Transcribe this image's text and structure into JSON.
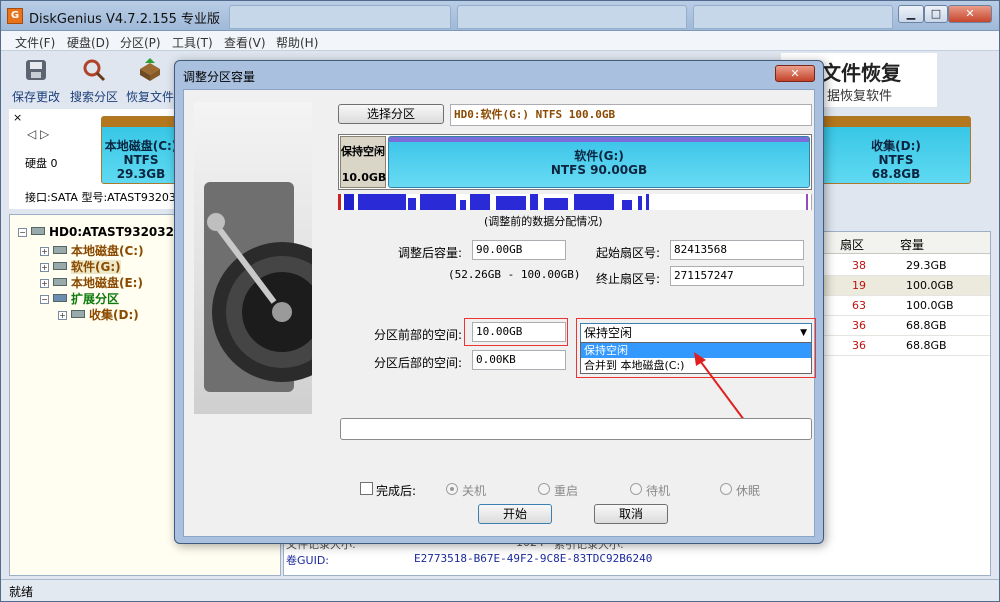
{
  "window": {
    "icon": "G",
    "title": "DiskGenius V4.7.2.155 专业版",
    "min_label": "▁",
    "max_label": "□",
    "close_label": "✕"
  },
  "menu": [
    "文件(F)",
    "硬盘(D)",
    "分区(P)",
    "工具(T)",
    "查看(V)",
    "帮助(H)"
  ],
  "toolbar": [
    {
      "label": "保存更改",
      "icon": "save-icon"
    },
    {
      "label": "搜索分区",
      "icon": "search-icon"
    },
    {
      "label": "恢复文件",
      "icon": "recover-icon"
    }
  ],
  "banner": {
    "line1": "文件恢复",
    "line2": "据恢复软件"
  },
  "disk_panel": {
    "close": "×",
    "nav": "◁ ▷",
    "disk_label": "硬盘 0",
    "iface": "接口:SATA  型号:ATAST93203"
  },
  "partitions_strip": [
    {
      "name": "本地磁盘(C:)",
      "fs": "NTFS",
      "size": "29.3GB"
    },
    {
      "name": "收集(D:)",
      "fs": "NTFS",
      "size": "68.8GB"
    }
  ],
  "tree": {
    "root": "HD0:ATAST9320325AS",
    "items": [
      {
        "label": "本地磁盘(C:)",
        "color": "#8b4a00"
      },
      {
        "label": "软件(G:)",
        "color": "#8b4a00"
      },
      {
        "label": "本地磁盘(E:)",
        "color": "#8b4a00"
      },
      {
        "label": "扩展分区",
        "color": "#0d7a0d"
      },
      {
        "label": "收集(D:)",
        "color": "#8b4a00"
      }
    ]
  },
  "table": {
    "headers": [
      "扇区",
      "容量"
    ],
    "rows": [
      {
        "sector": "38",
        "size": "29.3GB"
      },
      {
        "sector": "19",
        "size": "100.0GB"
      },
      {
        "sector": "63",
        "size": "100.0GB"
      },
      {
        "sector": "36",
        "size": "68.8GB"
      },
      {
        "sector": "36",
        "size": "68.8GB"
      }
    ],
    "record_label": "文件记录大小:",
    "record_value": "1024",
    "record_label2": "索引记录大小:",
    "guid_label": "卷GUID:",
    "guid_value": "E2773518-B67E-49F2-9C8E-83TDC92B6240"
  },
  "status": "就绪",
  "dialog": {
    "title": "调整分区容量",
    "close": "✕",
    "select_btn": "选择分区",
    "partition_info": "HD0:软件(G:) NTFS 100.0GB",
    "free_seg": {
      "name": "保持空闲",
      "size": "10.0GB"
    },
    "main_seg": {
      "name": "软件(G:)",
      "detail": "NTFS 90.00GB"
    },
    "dist_caption": "(调整前的数据分配情况)",
    "size_after_label": "调整后容量:",
    "size_after_value": "90.00GB",
    "range": "(52.26GB - 100.00GB)",
    "start_sector_label": "起始扇区号:",
    "start_sector_value": "82413568",
    "end_sector_label": "终止扇区号:",
    "end_sector_value": "271157247",
    "before_label": "分区前部的空间:",
    "before_value": "10.00GB",
    "after_label": "分区后部的空间:",
    "after_value": "0.00KB",
    "dropdown_value": "保持空闲",
    "dropdown_options": [
      "保持空闲",
      "合并到 本地磁盘(C:)"
    ],
    "done_label": "完成后:",
    "radios": [
      "关机",
      "重启",
      "待机",
      "休眠"
    ],
    "start_btn": "开始",
    "cancel_btn": "取消"
  },
  "watermark": {
    "brand": "Bai 经验",
    "url": "jingyan.baidu.com"
  }
}
